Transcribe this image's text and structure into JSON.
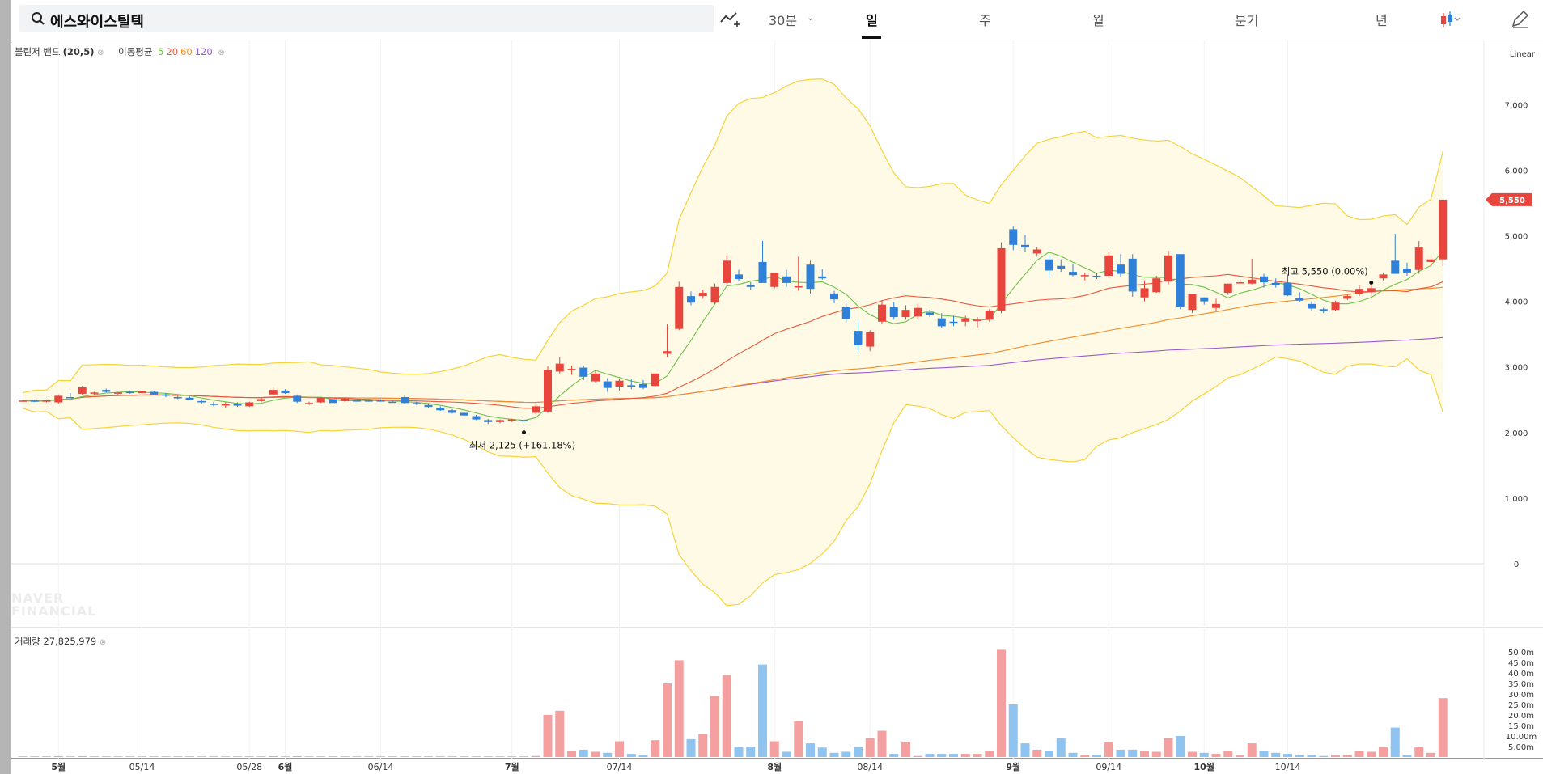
{
  "search": {
    "query": "에스와이스틸텍",
    "icon": "search-icon"
  },
  "toolbar": {
    "draw_icon": "trend-draw-icon",
    "interval": "30분",
    "periods": [
      "일",
      "주",
      "월",
      "분기",
      "년"
    ],
    "active_period": "일",
    "chart_type_icon": "candlestick-icon",
    "edit_icon": "pencil-icon"
  },
  "indicators": {
    "bollinger": "볼린저 밴드",
    "bollinger_params": "(20,5)",
    "ma_label": "이동평균",
    "ma_periods": [
      "5",
      "20",
      "60",
      "120"
    ],
    "volume_label": "거래량 27,825,979"
  },
  "scale_mode": "Linear",
  "watermark": [
    "NAVER",
    "FINANCIAL"
  ],
  "colors": {
    "up": "#e8453c",
    "down": "#2f80d8",
    "vol_up": "#f4a0a0",
    "vol_down": "#8fc3f0",
    "ma5": "#6cc04a",
    "ma20": "#e8583c",
    "ma60": "#f28c28",
    "ma120": "#9b59d0",
    "band_line": "#f7d33b",
    "band_fill": "#fffae6",
    "last_price": "#e8453c"
  },
  "chart_data": {
    "type": "candlestick",
    "price_axis": [
      0,
      1000,
      2000,
      3000,
      4000,
      5000,
      6000,
      7000
    ],
    "price_axis_labels": [
      "0",
      "1,000",
      "2,000",
      "3,000",
      "4,000",
      "5,000",
      "6,000",
      "7,000"
    ],
    "volume_axis_labels": [
      "5.00m",
      "10.00m",
      "15.0m",
      "20.0m",
      "25.0m",
      "30.0m",
      "35.0m",
      "40.0m",
      "45.0m",
      "50.0m"
    ],
    "x_labels": [
      "5월",
      "05/14",
      "05/28",
      "6월",
      "06/14",
      "7월",
      "07/14",
      "8월",
      "08/14",
      "9월",
      "09/14",
      "10월",
      "10/14"
    ],
    "x_label_index": [
      3,
      10,
      19,
      22,
      30,
      41,
      50,
      63,
      71,
      83,
      91,
      99,
      106
    ],
    "high_annotation": "최고 5,550 (0.00%)",
    "low_annotation": "최저 2,125 (+161.18%)",
    "high_index": 113,
    "low_index": 42,
    "last_price": "5,550",
    "candles": [
      [
        2480,
        2495,
        2470,
        2488,
        0.3
      ],
      [
        2488,
        2500,
        2465,
        2470,
        0.3
      ],
      [
        2470,
        2505,
        2460,
        2490,
        0.3
      ],
      [
        2460,
        2580,
        2440,
        2560,
        0.4
      ],
      [
        2540,
        2600,
        2520,
        2530,
        0.3
      ],
      [
        2590,
        2710,
        2570,
        2690,
        0.4
      ],
      [
        2600,
        2620,
        2580,
        2610,
        0.3
      ],
      [
        2650,
        2670,
        2610,
        2620,
        0.3
      ],
      [
        2600,
        2620,
        2580,
        2610,
        0.3
      ],
      [
        2620,
        2640,
        2590,
        2600,
        0.3
      ],
      [
        2600,
        2640,
        2590,
        2630,
        0.3
      ],
      [
        2620,
        2640,
        2570,
        2580,
        0.3
      ],
      [
        2580,
        2600,
        2540,
        2560,
        0.3
      ],
      [
        2540,
        2560,
        2510,
        2530,
        0.3
      ],
      [
        2530,
        2550,
        2490,
        2500,
        0.3
      ],
      [
        2480,
        2500,
        2440,
        2460,
        0.3
      ],
      [
        2440,
        2470,
        2400,
        2420,
        0.3
      ],
      [
        2430,
        2460,
        2380,
        2430,
        0.3
      ],
      [
        2430,
        2460,
        2390,
        2410,
        0.3
      ],
      [
        2400,
        2470,
        2390,
        2460,
        0.3
      ],
      [
        2480,
        2530,
        2460,
        2510,
        0.3
      ],
      [
        2580,
        2680,
        2560,
        2650,
        0.4
      ],
      [
        2640,
        2660,
        2590,
        2600,
        0.3
      ],
      [
        2560,
        2580,
        2450,
        2470,
        0.4
      ],
      [
        2440,
        2470,
        2420,
        2450,
        0.3
      ],
      [
        2460,
        2540,
        2450,
        2530,
        0.3
      ],
      [
        2510,
        2530,
        2440,
        2450,
        0.3
      ],
      [
        2480,
        2530,
        2470,
        2520,
        0.3
      ],
      [
        2490,
        2510,
        2470,
        2480,
        0.3
      ],
      [
        2490,
        2510,
        2470,
        2480,
        0.3
      ],
      [
        2490,
        2510,
        2470,
        2480,
        0.3
      ],
      [
        2470,
        2490,
        2450,
        2460,
        0.3
      ],
      [
        2540,
        2560,
        2440,
        2450,
        0.3
      ],
      [
        2450,
        2470,
        2420,
        2430,
        0.3
      ],
      [
        2420,
        2440,
        2380,
        2390,
        0.3
      ],
      [
        2380,
        2400,
        2330,
        2340,
        0.3
      ],
      [
        2340,
        2360,
        2290,
        2300,
        0.3
      ],
      [
        2300,
        2320,
        2250,
        2260,
        0.3
      ],
      [
        2250,
        2270,
        2190,
        2200,
        0.3
      ],
      [
        2190,
        2210,
        2130,
        2160,
        0.3
      ],
      [
        2160,
        2200,
        2140,
        2190,
        0.3
      ],
      [
        2180,
        2210,
        2160,
        2200,
        0.3
      ],
      [
        2190,
        2210,
        2125,
        2180,
        0.3
      ],
      [
        2300,
        2430,
        2280,
        2400,
        0.5
      ],
      [
        2320,
        3010,
        2300,
        2960,
        20.0
      ],
      [
        2930,
        3150,
        2900,
        3050,
        22.0
      ],
      [
        2950,
        3020,
        2880,
        2970,
        3.0
      ],
      [
        2990,
        3020,
        2800,
        2850,
        3.5
      ],
      [
        2780,
        2950,
        2760,
        2900,
        2.5
      ],
      [
        2780,
        2830,
        2620,
        2680,
        2.0
      ],
      [
        2700,
        2820,
        2640,
        2790,
        7.5
      ],
      [
        2720,
        2810,
        2660,
        2700,
        1.5
      ],
      [
        2740,
        2800,
        2660,
        2680,
        1.0
      ],
      [
        2710,
        2900,
        2700,
        2900,
        8.0
      ],
      [
        3200,
        3650,
        3150,
        3240,
        35.0
      ],
      [
        3580,
        4300,
        3560,
        4220,
        46.0
      ],
      [
        4080,
        4150,
        3940,
        3980,
        8.5
      ],
      [
        4080,
        4180,
        4040,
        4130,
        11.0
      ],
      [
        3980,
        4270,
        3960,
        4220,
        29.0
      ],
      [
        4280,
        4700,
        4260,
        4620,
        39.0
      ],
      [
        4410,
        4480,
        4310,
        4340,
        5.0
      ],
      [
        4250,
        4290,
        4170,
        4220,
        5.0
      ],
      [
        4600,
        4920,
        4360,
        4280,
        44.0
      ],
      [
        4220,
        4440,
        4200,
        4440,
        7.5
      ],
      [
        4380,
        4480,
        4220,
        4280,
        2.5
      ],
      [
        4230,
        4680,
        4160,
        4230,
        17.0
      ],
      [
        4560,
        4620,
        4120,
        4190,
        6.5
      ],
      [
        4380,
        4490,
        4330,
        4350,
        4.5
      ],
      [
        4120,
        4160,
        3970,
        4030,
        2.0
      ],
      [
        3910,
        3970,
        3680,
        3730,
        2.5
      ],
      [
        3550,
        3700,
        3230,
        3330,
        5.0
      ],
      [
        3310,
        3560,
        3240,
        3530,
        9.0
      ],
      [
        3690,
        4020,
        3660,
        3950,
        12.5
      ],
      [
        3920,
        3990,
        3720,
        3760,
        1.5
      ],
      [
        3760,
        3940,
        3720,
        3870,
        7.0
      ],
      [
        3770,
        3960,
        3720,
        3900,
        0.5
      ],
      [
        3830,
        3870,
        3760,
        3790,
        1.5
      ],
      [
        3740,
        3820,
        3600,
        3620,
        1.5
      ],
      [
        3690,
        3780,
        3620,
        3680,
        1.5
      ],
      [
        3690,
        3780,
        3620,
        3740,
        1.5
      ],
      [
        3700,
        3760,
        3600,
        3720,
        1.5
      ],
      [
        3720,
        3880,
        3690,
        3860,
        3.0
      ],
      [
        3860,
        4900,
        3820,
        4810,
        51.0
      ],
      [
        5100,
        5140,
        4780,
        4860,
        25.0
      ],
      [
        4860,
        5010,
        4750,
        4820,
        6.5
      ],
      [
        4730,
        4830,
        4680,
        4790,
        3.5
      ],
      [
        4640,
        4710,
        4360,
        4470,
        3.0
      ],
      [
        4540,
        4640,
        4450,
        4500,
        9.0
      ],
      [
        4450,
        4570,
        4380,
        4400,
        2.0
      ],
      [
        4390,
        4440,
        4320,
        4400,
        1.0
      ],
      [
        4390,
        4430,
        4340,
        4370,
        1.0
      ],
      [
        4390,
        4760,
        4360,
        4700,
        7.0
      ],
      [
        4560,
        4720,
        4380,
        4420,
        3.5
      ],
      [
        4650,
        4720,
        4070,
        4150,
        3.5
      ],
      [
        4060,
        4320,
        4000,
        4200,
        3.0
      ],
      [
        4140,
        4390,
        4130,
        4350,
        2.5
      ],
      [
        4300,
        4770,
        4260,
        4700,
        9.0
      ],
      [
        4720,
        4710,
        3880,
        3920,
        10.0
      ],
      [
        3870,
        4060,
        3820,
        4110,
        2.5
      ],
      [
        4060,
        4060,
        3950,
        4000,
        2.0
      ],
      [
        3900,
        4040,
        3860,
        3960,
        1.5
      ],
      [
        4130,
        4270,
        4100,
        4270,
        3.0
      ],
      [
        4290,
        4330,
        4280,
        4290,
        1.0
      ],
      [
        4270,
        4650,
        4260,
        4330,
        6.5
      ],
      [
        4380,
        4420,
        4210,
        4290,
        3.0
      ],
      [
        4280,
        4350,
        4210,
        4250,
        2.0
      ],
      [
        4280,
        4410,
        4080,
        4090,
        1.5
      ],
      [
        4050,
        4140,
        3990,
        4010,
        1.0
      ],
      [
        3960,
        4000,
        3860,
        3890,
        1.0
      ],
      [
        3880,
        3900,
        3820,
        3850,
        0.5
      ],
      [
        3870,
        4010,
        3860,
        3980,
        1.0
      ],
      [
        4040,
        4120,
        4020,
        4080,
        1.0
      ],
      [
        4110,
        4250,
        4080,
        4190,
        3.0
      ],
      [
        4140,
        4260,
        4100,
        4200,
        2.5
      ],
      [
        4350,
        4440,
        4320,
        4410,
        5.0
      ],
      [
        4620,
        5030,
        4540,
        4420,
        14.0
      ],
      [
        4500,
        4590,
        4390,
        4440,
        1.0
      ],
      [
        4480,
        4920,
        4420,
        4820,
        5.0
      ],
      [
        4600,
        4680,
        4530,
        4640,
        2.0
      ],
      [
        4640,
        5550,
        4540,
        5550,
        28.0
      ]
    ]
  }
}
